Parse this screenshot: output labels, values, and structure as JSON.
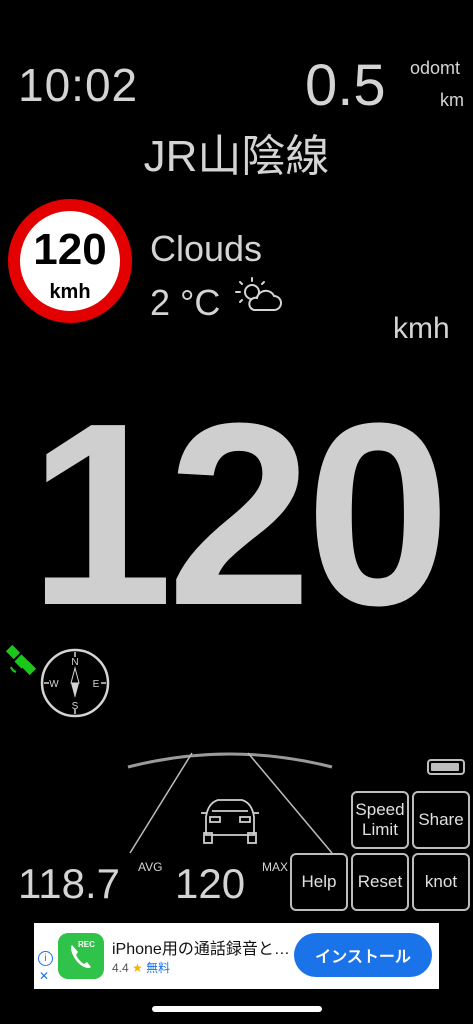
{
  "header": {
    "time": "10:02",
    "odometer_value": "0.5",
    "odometer_label": "odomt",
    "odometer_unit": "km",
    "line_name": "JR山陰線"
  },
  "speed_limit": {
    "value": "120",
    "unit": "kmh",
    "ring_color": "#e30000"
  },
  "weather": {
    "condition": "Clouds",
    "temperature": "2 °C",
    "icon": "partly-cloudy-icon"
  },
  "speed": {
    "unit": "kmh",
    "current": "120"
  },
  "compass": {
    "north": "N",
    "south": "S",
    "east": "E",
    "west": "W"
  },
  "gps": {
    "icon": "satellite-icon",
    "color": "#19c919"
  },
  "battery": {
    "level": 0.95
  },
  "stats": {
    "avg_value": "118.7",
    "avg_label": "AVG",
    "max_value": "120",
    "max_label": "MAX"
  },
  "buttons": {
    "speed_limit_line1": "Speed",
    "speed_limit_line2": "Limit",
    "share": "Share",
    "help": "Help",
    "reset": "Reset",
    "knot": "knot"
  },
  "ad": {
    "app_icon_label": "REC",
    "title": "iPhone用の通話録音と…",
    "rating": "4.4",
    "star": "★",
    "price": "無料",
    "install": "インストール",
    "info_glyph": "i",
    "close_glyph": "✕"
  }
}
